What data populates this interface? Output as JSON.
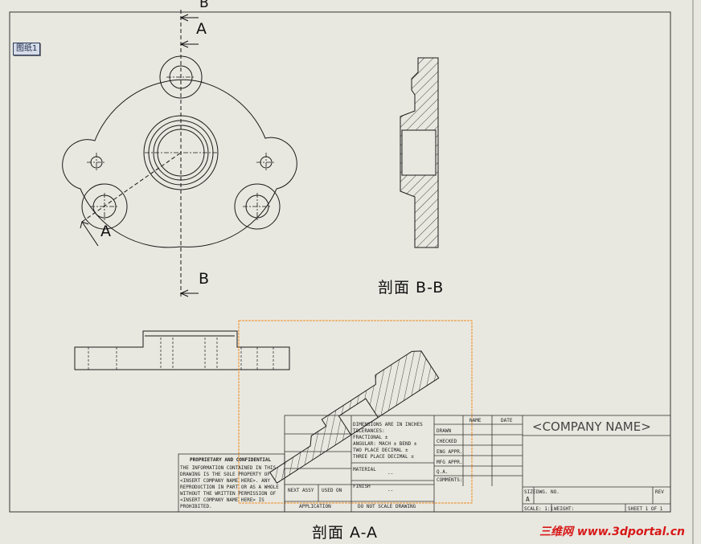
{
  "sheet_tab": "图纸1",
  "section_labels": {
    "top_b": "B",
    "top_a": "A",
    "left_a": "A",
    "bottom_b": "B"
  },
  "titles": {
    "section_bb": "剖面 B-B",
    "section_aa": "剖面 A-A"
  },
  "title_block": {
    "company": "<COMPANY NAME>",
    "col_name": "NAME",
    "col_date": "DATE",
    "rows": [
      "DRAWN",
      "CHECKED",
      "ENG APPR.",
      "MFG APPR.",
      "Q.A.",
      "COMMENTS:"
    ],
    "notes": [
      "DIMENSIONS ARE IN INCHES",
      "TOLERANCES:",
      "FRACTIONAL ±",
      "ANGULAR: MACH ±   BEND ±",
      "TWO PLACE DECIMAL   ±",
      "THREE PLACE DECIMAL  ±"
    ],
    "material": "MATERIAL",
    "finish": "FINISH",
    "dash": "--",
    "next_assy": "NEXT ASSY",
    "used_on": "USED ON",
    "application": "APPLICATION",
    "do_not_scale": "DO NOT SCALE DRAWING",
    "size": "SIZE",
    "size_value": "A",
    "dwg_no": "DWG. NO.",
    "rev": "REV",
    "scale": "SCALE: 1:1",
    "weight": "WEIGHT:",
    "sheet": "SHEET 1 OF 1"
  },
  "proprietary": {
    "heading": "PROPRIETARY AND CONFIDENTIAL",
    "lines": [
      "THE INFORMATION CONTAINED IN THIS",
      "DRAWING IS THE SOLE PROPERTY OF",
      "<INSERT COMPANY NAME HERE>.  ANY",
      "REPRODUCTION IN PART OR AS A WHOLE",
      "WITHOUT THE WRITTEN PERMISSION OF",
      "<INSERT COMPANY NAME HERE> IS",
      "PROHIBITED."
    ]
  },
  "watermark": "三维网 www.3dportal.cn",
  "colors": {
    "background": "#e8e8e0",
    "line": "#1a1a1a",
    "selection": "#f08a20",
    "watermark": "#d81818"
  }
}
